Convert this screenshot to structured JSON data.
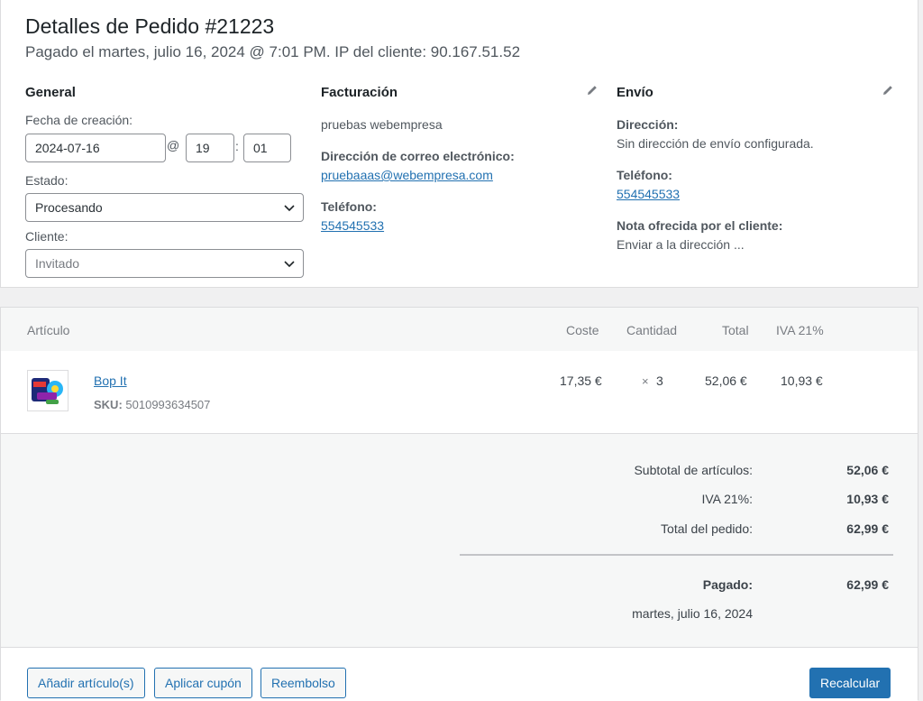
{
  "header": {
    "title": "Detalles de Pedido #21223",
    "subtitle": "Pagado el martes, julio 16, 2024 @ 7:01 PM. IP del cliente: 90.167.51.52"
  },
  "general": {
    "heading": "General",
    "date_label": "Fecha de creación:",
    "date_value": "2024-07-16",
    "at_sep": "@",
    "hour": "19",
    "time_sep": ":",
    "minute": "01",
    "status_label": "Estado:",
    "status_value": "Procesando",
    "customer_label": "Cliente:",
    "customer_placeholder": "Invitado"
  },
  "billing": {
    "heading": "Facturación",
    "name": "pruebas webempresa",
    "email_label": "Dirección de correo electrónico:",
    "email": "pruebaaas@webempresa.com",
    "phone_label": "Teléfono:",
    "phone": "554545533"
  },
  "shipping": {
    "heading": "Envío",
    "address_label": "Dirección:",
    "address_value": "Sin dirección de envío configurada.",
    "phone_label": "Teléfono:",
    "phone": "554545533",
    "note_label": "Nota ofrecida por el cliente:",
    "note_value": "Enviar a la dirección ..."
  },
  "items": {
    "columns": {
      "article": "Artículo",
      "cost": "Coste",
      "quantity": "Cantidad",
      "total": "Total",
      "tax": "IVA 21%"
    },
    "rows": [
      {
        "name": "Bop It",
        "sku_label": "SKU:",
        "sku": "5010993634507",
        "cost": "17,35 €",
        "qty_prefix": "×",
        "qty": "3",
        "total": "52,06 €",
        "tax": "10,93 €"
      }
    ]
  },
  "totals": {
    "subtotal_label": "Subtotal de artículos:",
    "subtotal_value": "52,06 €",
    "tax_label": "IVA 21%:",
    "tax_value": "10,93 €",
    "order_total_label": "Total del pedido:",
    "order_total_value": "62,99 €",
    "paid_label": "Pagado:",
    "paid_value": "62,99 €",
    "paid_date": "martes, julio 16, 2024"
  },
  "actions": {
    "add_items": "Añadir artículo(s)",
    "apply_coupon": "Aplicar cupón",
    "refund": "Reembolso",
    "recalculate": "Recalcular"
  },
  "colors": {
    "accent": "#2271b1",
    "panel_bg": "#ffffff",
    "page_bg": "#f0f0f1"
  }
}
